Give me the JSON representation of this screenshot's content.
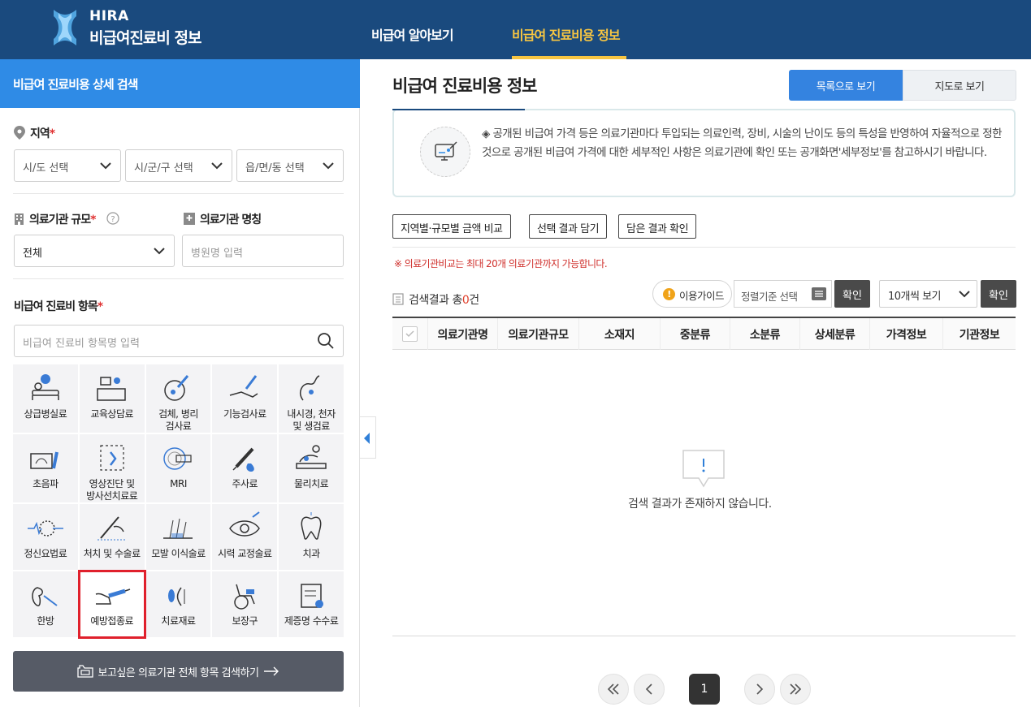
{
  "header": {
    "logo_en": "HIRA",
    "logo_ko": "비급여진료비 정보",
    "nav": [
      "비급여 알아보기",
      "비급여 진료비용 정보"
    ],
    "active_nav": "비급여 진료비용 정보"
  },
  "sidebar": {
    "title": "비급여 진료비용 상세 검색",
    "region": {
      "label": "지역",
      "required": "*",
      "selects": [
        "시/도 선택",
        "시/군/구 선택",
        "읍/면/동 선택"
      ]
    },
    "scale": {
      "label": "의료기관 규모",
      "required": "*",
      "value": "전체"
    },
    "name": {
      "label": "의료기관 명칭",
      "placeholder": "병원명 입력"
    },
    "items": {
      "label": "비급여 진료비 항목",
      "required": "*",
      "search_placeholder": "비급여 진료비 항목명 입력",
      "tiles": [
        {
          "label": "상급병실료",
          "icon": "hospital-bed-icon"
        },
        {
          "label": "교육상담료",
          "icon": "counseling-icon"
        },
        {
          "label": "검체, 병리\n검사료",
          "icon": "specimen-icon"
        },
        {
          "label": "기능검사료",
          "icon": "function-test-icon"
        },
        {
          "label": "내시경, 천자\n및 생검료",
          "icon": "endoscope-icon"
        },
        {
          "label": "초음파",
          "icon": "ultrasound-icon"
        },
        {
          "label": "영상진단 및\n방사선치료료",
          "icon": "radiology-icon"
        },
        {
          "label": "MRI",
          "icon": "mri-icon"
        },
        {
          "label": "주사료",
          "icon": "injection-icon"
        },
        {
          "label": "물리치료",
          "icon": "physical-therapy-icon"
        },
        {
          "label": "정신요법료",
          "icon": "brain-icon"
        },
        {
          "label": "처치 및 수술료",
          "icon": "surgery-icon"
        },
        {
          "label": "모발 이식술료",
          "icon": "hair-transplant-icon"
        },
        {
          "label": "시력 교정술료",
          "icon": "eye-icon"
        },
        {
          "label": "치과",
          "icon": "tooth-icon"
        },
        {
          "label": "한방",
          "icon": "acupuncture-icon"
        },
        {
          "label": "예방접종료",
          "icon": "vaccine-icon"
        },
        {
          "label": "치료재료",
          "icon": "treatment-material-icon"
        },
        {
          "label": "보장구",
          "icon": "wheelchair-icon"
        },
        {
          "label": "제증명 수수료",
          "icon": "certificate-icon"
        }
      ],
      "selected_tile": "예방접종료"
    },
    "search_all_button": "보고싶은 의료기관 전체 항목 검색하기"
  },
  "main": {
    "title": "비급여 진료비용 정보",
    "view_buttons": [
      "목록으로 보기",
      "지도로 보기"
    ],
    "notice": "◈ 공개된 비급여 가격 등은 의료기관마다 투입되는 의료인력, 장비, 시술의 난이도 등의 특성을 반영하여 자율적으로 정한 것으로 공개된 비급여 가격에 대한 세부적인 사항은 의료기관에 확인 또는 공개화면'세부정보'를 참고하시기 바랍니다.",
    "action_buttons": [
      "지역별·규모별 금액 비교",
      "선택 결과 담기",
      "담은 결과 확인"
    ],
    "warning": "※ 의료기관비교는 최대 20개 의료기관까지 가능합니다.",
    "result_prefix": "검색결과 총",
    "result_count": "0",
    "result_suffix": "건",
    "guide_button": "이용가이드",
    "sort_placeholder": "정렬기준 선택",
    "confirm": "확인",
    "page_size": "10개씩 보기",
    "columns": [
      "의료기관명",
      "의료기관규모",
      "소재지",
      "중분류",
      "소분류",
      "상세분류",
      "가격정보",
      "기관정보"
    ],
    "empty_message": "검색 결과가 존재하지 않습니다.",
    "pagination": {
      "current": "1"
    }
  },
  "colors": {
    "header_bg": "#1a4a7e",
    "accent_yellow": "#f6c542",
    "sidebar_title_bg": "#2f8be6",
    "primary_blue": "#3483e0",
    "required_red": "#e03232",
    "highlight_red": "#e0202c"
  }
}
